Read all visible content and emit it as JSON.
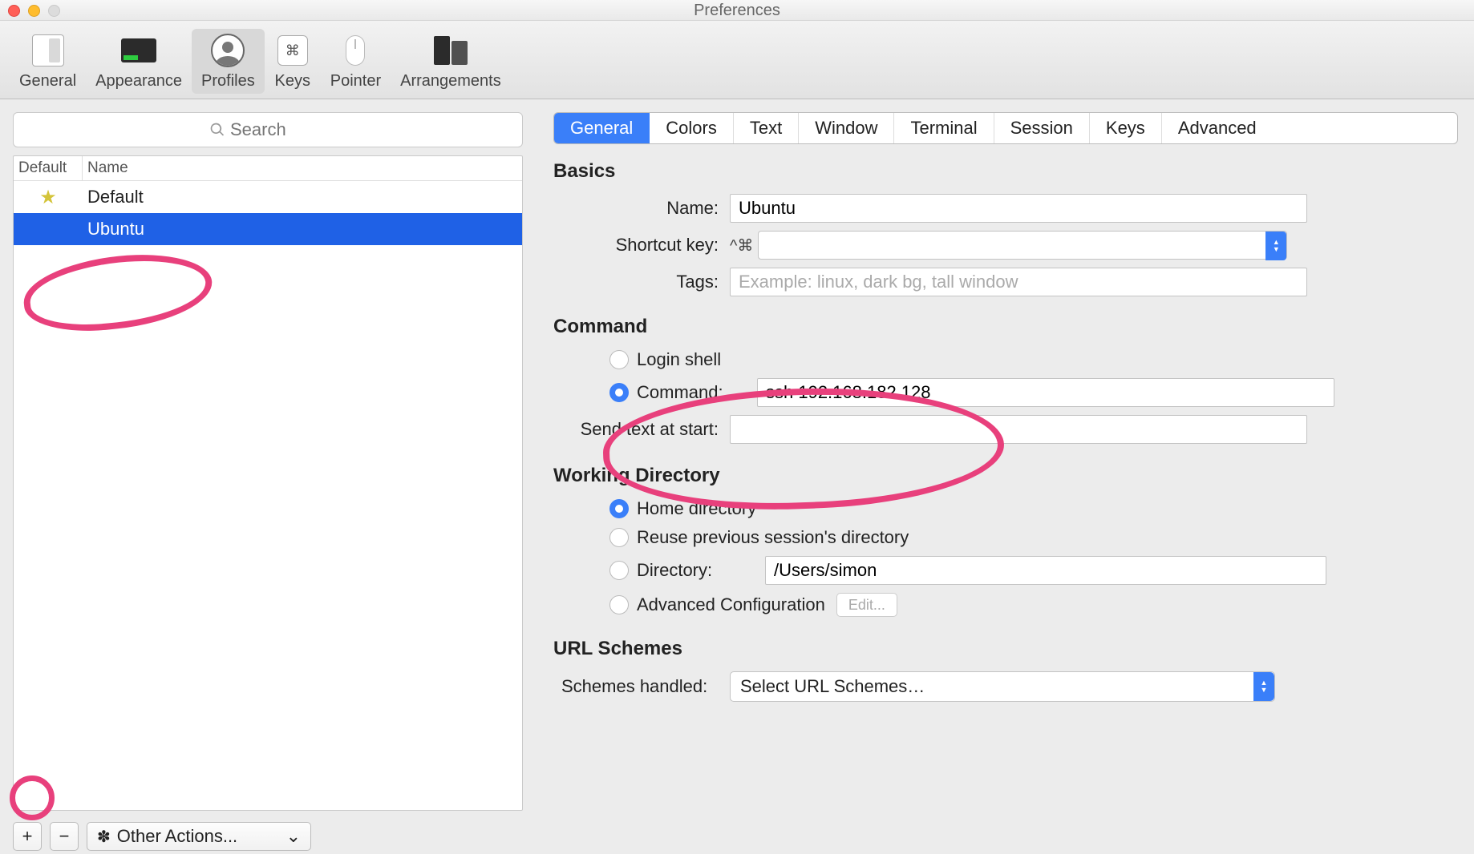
{
  "window": {
    "title": "Preferences"
  },
  "toolbar": {
    "items": [
      {
        "label": "General"
      },
      {
        "label": "Appearance"
      },
      {
        "label": "Profiles"
      },
      {
        "label": "Keys"
      },
      {
        "label": "Pointer"
      },
      {
        "label": "Arrangements"
      }
    ]
  },
  "sidebar": {
    "search_placeholder": "Search",
    "columns": {
      "default": "Default",
      "name": "Name"
    },
    "rows": [
      {
        "name": "Default",
        "is_default": true
      },
      {
        "name": "Ubuntu",
        "is_default": false
      }
    ],
    "add": "+",
    "remove": "−",
    "other_actions": "Other Actions..."
  },
  "tabs": {
    "items": [
      "General",
      "Colors",
      "Text",
      "Window",
      "Terminal",
      "Session",
      "Keys",
      "Advanced"
    ]
  },
  "form": {
    "basics_title": "Basics",
    "name_label": "Name:",
    "name_value": "Ubuntu",
    "shortcut_label": "Shortcut key:",
    "shortcut_symbols": "^⌘",
    "shortcut_value": "",
    "tags_label": "Tags:",
    "tags_placeholder": "Example: linux, dark bg, tall window",
    "command_title": "Command",
    "login_shell": "Login shell",
    "command_label": "Command:",
    "command_value": "ssh 192.168.182.128",
    "send_text_label": "Send text at start:",
    "send_text_value": "",
    "wd_title": "Working Directory",
    "wd_home": "Home directory",
    "wd_reuse": "Reuse previous session's directory",
    "wd_dir_label": "Directory:",
    "wd_dir_value": "/Users/simon",
    "wd_adv": "Advanced Configuration",
    "wd_edit": "Edit...",
    "url_title": "URL Schemes",
    "url_label": "Schemes handled:",
    "url_select": "Select URL Schemes…"
  }
}
